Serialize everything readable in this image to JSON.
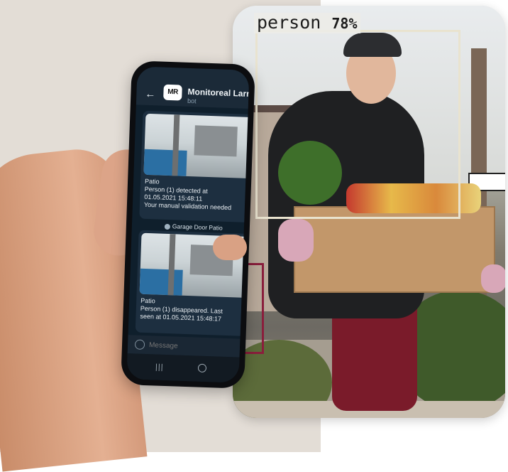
{
  "detection": {
    "label": "person",
    "confidence": "78%",
    "box_color": "#e9e3cf",
    "secondary_box_color": "#8a1e3c"
  },
  "app": {
    "chat_title": "Monitoreal Larr",
    "chat_subtitle": "bot",
    "logo_text": "MR"
  },
  "messages": [
    {
      "lines": [
        "Patio",
        "Person (1) detected at",
        "01.05.2021 15:48:11",
        "Your manual validation needed"
      ]
    },
    {
      "lines": [
        "Patio",
        "Person (1) disappeared. Last",
        "seen at 01.05.2021 15:48:17"
      ]
    }
  ],
  "reply_chip": "Garage Door Patio",
  "composer": {
    "placeholder": "Message"
  },
  "colors": {
    "background": "#e3ddd6",
    "chat_bg": "#0f1f2c",
    "bubble": "#1d2f40"
  }
}
